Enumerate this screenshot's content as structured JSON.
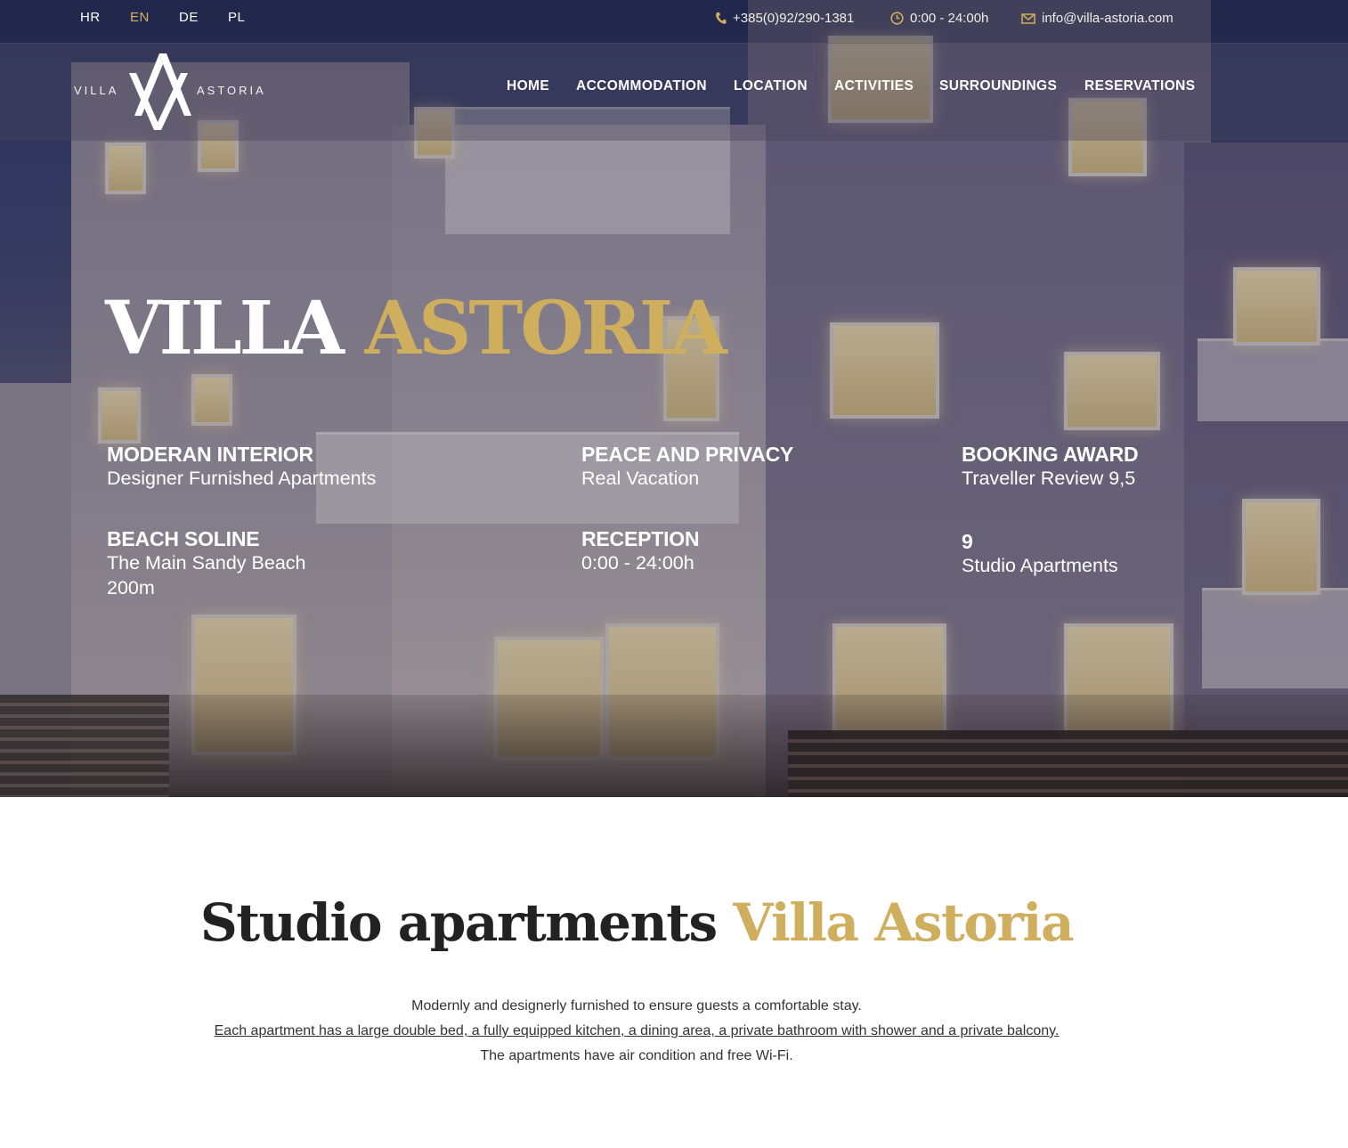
{
  "languages": [
    {
      "code": "HR",
      "active": false
    },
    {
      "code": "EN",
      "active": true
    },
    {
      "code": "DE",
      "active": false
    },
    {
      "code": "PL",
      "active": false
    }
  ],
  "contact": {
    "phone": "+385(0)92/290-1381",
    "hours": "0:00 - 24:00h",
    "email": "info@villa-astoria.com"
  },
  "logo": {
    "left_word": "VILLA",
    "right_word": "ASTORIA"
  },
  "nav": [
    "HOME",
    "ACCOMMODATION",
    "LOCATION",
    "ACTIVITIES",
    "SURROUNDINGS",
    "RESERVATIONS"
  ],
  "hero": {
    "title_white": "VILLA",
    "title_gold": "ASTORIA",
    "features": [
      {
        "title": "MODERAN INTERIOR",
        "subtitle": "Designer Furnished Apartments"
      },
      {
        "title": "PEACE AND PRIVACY",
        "subtitle": "Real Vacation"
      },
      {
        "title": "BOOKING AWARD",
        "subtitle": "Traveller Review 9,5"
      },
      {
        "title": "BEACH SOLINE",
        "subtitle": "The Main Sandy Beach",
        "subtitle2": "200m"
      },
      {
        "title": "RECEPTION",
        "subtitle": "0:00 - 24:00h"
      },
      {
        "title": "9",
        "subtitle": "Studio Apartments"
      }
    ]
  },
  "intro": {
    "heading_dark": "Studio apartments",
    "heading_gold": "Villa Astoria",
    "line1": "Modernly and designerly furnished to ensure guests a comfortable stay.",
    "line2": "Each apartment has a large double bed, a fully equipped kitchen, a dining area, a private bathroom with shower and a private balcony.",
    "line3": "The apartments have air condition and free Wi-Fi."
  },
  "colors": {
    "gold": "#cfae5d",
    "dark_text": "#222222"
  },
  "icons": [
    "phone-icon",
    "clock-icon",
    "mail-icon"
  ]
}
